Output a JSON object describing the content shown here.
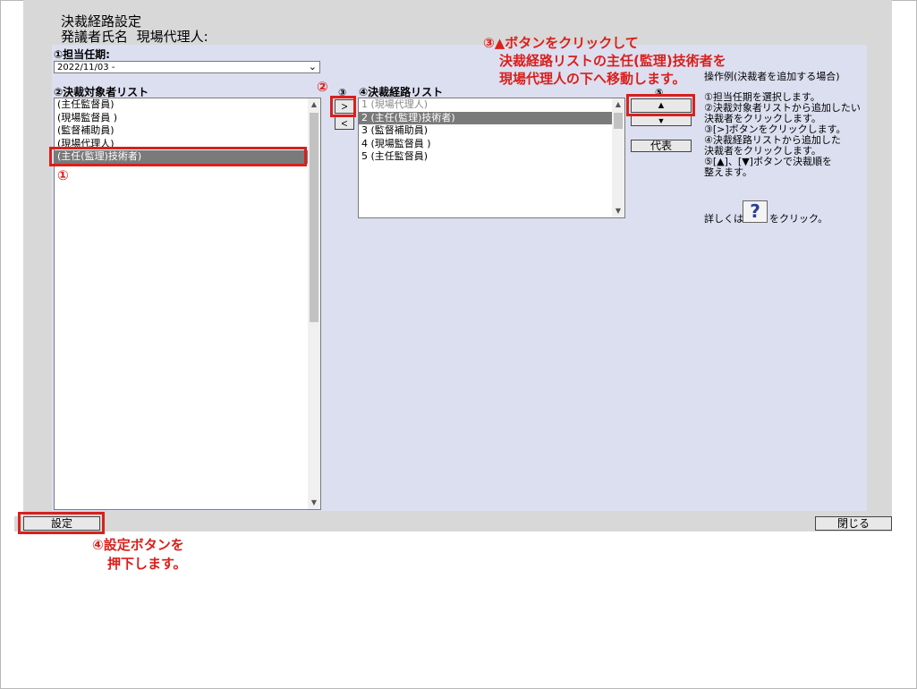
{
  "header": {
    "title": "決裁経路設定",
    "requester_label": "発議者氏名",
    "requester_value": "現場代理人:"
  },
  "term": {
    "label": "①担当任期:",
    "value": "2022/11/03 -"
  },
  "candidates": {
    "label": "②決裁対象者リスト",
    "items": [
      "(主任監督員)",
      "(現場監督員 )",
      "(監督補助員)",
      "(現場代理人)",
      "(主任(監理)技術者)"
    ]
  },
  "transfer": {
    "step_label": "③",
    "add_label": ">",
    "remove_label": "<"
  },
  "route": {
    "label": "④決裁経路リスト",
    "items": [
      "1 (現場代理人)",
      "2 (主任(監理)技術者)",
      "3 (監督補助員)",
      "4 (現場監督員 )",
      "5 (主任監督員)"
    ]
  },
  "order": {
    "step_label": "⑤",
    "up_label": "▲",
    "down_label": "▼",
    "rep_label": "代表"
  },
  "help": {
    "heading": "操作例(決裁者を追加する場合)",
    "lines": [
      "①担当任期を選択します。",
      "②決裁対象者リストから追加したい",
      "決裁者をクリックします。",
      "③[>]ボタンをクリックします。",
      "④決裁経路リストから追加した",
      "決裁者をクリックします。",
      "⑤[▲]、[▼]ボタンで決裁順を",
      "整えます。"
    ],
    "more_prefix": "詳しくは",
    "more_icon": "?",
    "more_suffix": "をクリック。"
  },
  "footer": {
    "set_label": "設定",
    "close_label": "閉じる"
  },
  "annotations": {
    "a1": "①",
    "a2": "②",
    "a3_line1": "③▲ボタンをクリックして",
    "a3_line2": "決裁経路リストの主任(監理)技術者を",
    "a3_line3": "現場代理人の下へ移動します。",
    "a4_line1": "④設定ボタンを",
    "a4_line2": "押下します。"
  },
  "colors": {
    "annotation_red": "#d9201c",
    "panel": "#dcdff0",
    "selected": "#7a7a7a"
  }
}
